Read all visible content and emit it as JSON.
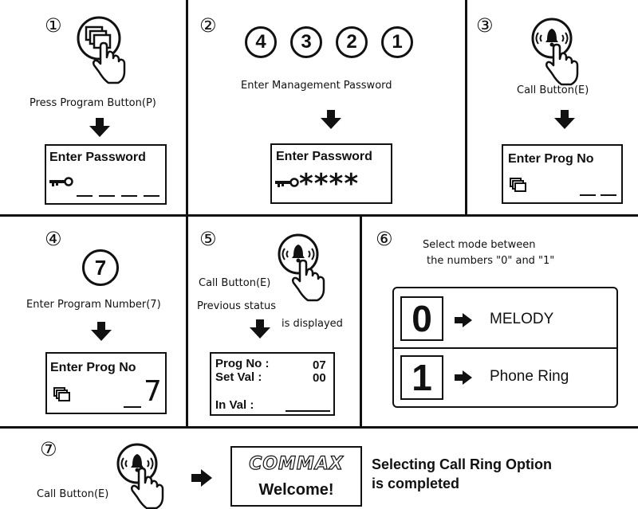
{
  "steps": [
    {
      "num": "①",
      "caption": "Press Program Button(P)",
      "lcd_title": "Enter Password"
    },
    {
      "num": "②",
      "digits": [
        "4",
        "3",
        "2",
        "1"
      ],
      "caption": "Enter Management Password",
      "lcd_title": "Enter Password",
      "lcd_value": "****"
    },
    {
      "num": "③",
      "caption": "Call Button(E)",
      "lcd_title": "Enter Prog  No"
    },
    {
      "num": "④",
      "digit": "7",
      "caption": "Enter Program Number(7)",
      "lcd_title": "Enter Prog  No",
      "lcd_value": "7"
    },
    {
      "num": "⑤",
      "caption1": "Call Button(E)",
      "caption2": "Previous status",
      "caption3": "is displayed",
      "lcd_prog_label": "Prog No :",
      "lcd_prog_val": "07",
      "lcd_set_label": "Set Val  :",
      "lcd_set_val": "00",
      "lcd_in_label": "In Val :"
    },
    {
      "num": "⑥",
      "caption_line1": "Select mode between",
      "caption_line2": "the numbers \"0\" and \"1\"",
      "modes": [
        {
          "digit": "0",
          "label": "MELODY"
        },
        {
          "digit": "1",
          "label": "Phone Ring"
        }
      ]
    },
    {
      "num": "⑦",
      "caption": "Call Button(E)",
      "brand": "COMMAX",
      "welcome": "Welcome!",
      "result_line1": "Selecting Call Ring Option",
      "result_line2": "is completed"
    }
  ]
}
